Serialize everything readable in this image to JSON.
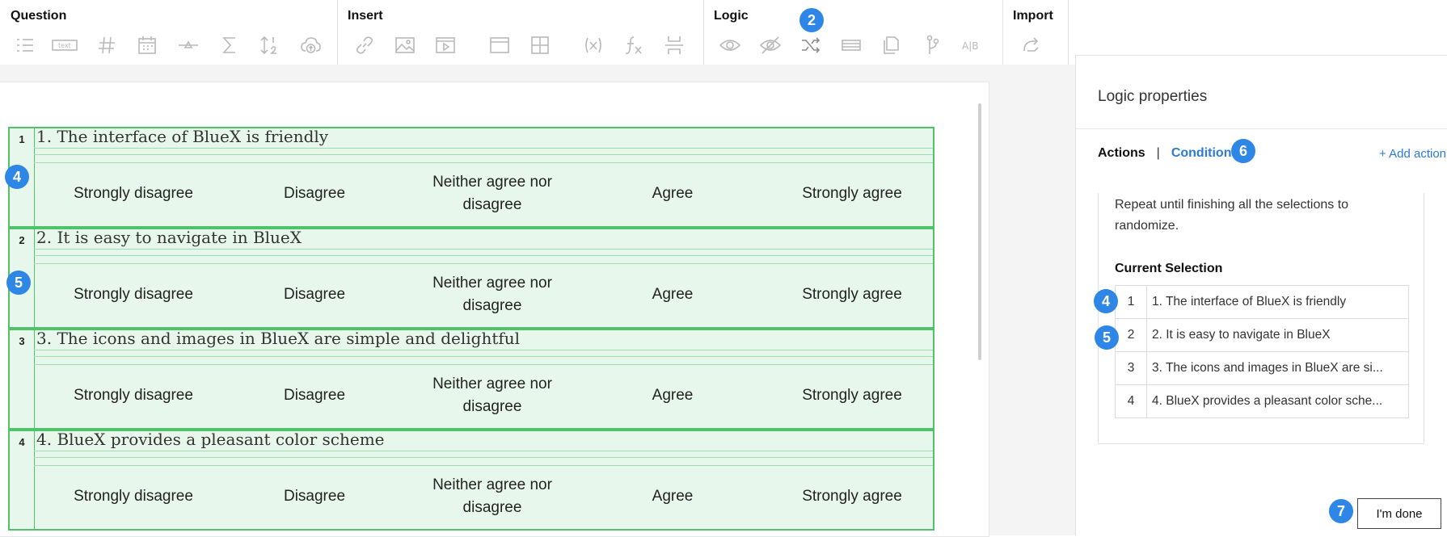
{
  "toolbar": {
    "groups": [
      {
        "title": "Question"
      },
      {
        "title": "Insert"
      },
      {
        "title": "Logic"
      },
      {
        "title": "Import"
      }
    ],
    "text_icon_label": "text"
  },
  "questions": [
    {
      "number": "1",
      "text": "1. The interface of BlueX is friendly"
    },
    {
      "number": "2",
      "text": "2. It is easy to navigate in BlueX"
    },
    {
      "number": "3",
      "text": "3. The icons and images in BlueX are simple and delightful"
    },
    {
      "number": "4",
      "text": "4. BlueX provides a pleasant color scheme"
    }
  ],
  "scale_options": [
    "Strongly disagree",
    "Disagree",
    "Neither agree nor disagree",
    "Agree",
    "Strongly agree"
  ],
  "panel": {
    "title": "Logic properties",
    "tab_actions": "Actions",
    "tab_separator": "|",
    "tab_conditions": "Conditions",
    "add_action": "+ Add action",
    "description": "Repeat until finishing all the selections to randomize.",
    "current_selection_label": "Current Selection",
    "selections": [
      {
        "number": "1",
        "text": "1. The interface of BlueX is friendly"
      },
      {
        "number": "2",
        "text": "2. It is easy to navigate in BlueX"
      },
      {
        "number": "3",
        "text": "3. The icons and images in BlueX are si..."
      },
      {
        "number": "4",
        "text": "4. BlueX provides a pleasant color sche..."
      }
    ],
    "done_button": "I'm done"
  },
  "badges": {
    "logic": "2",
    "q1": "4",
    "q2": "5",
    "conditions": "6",
    "sel1": "4",
    "sel2": "5",
    "done": "7"
  },
  "colors": {
    "accent": "#2e86e6",
    "question_border": "#4fc36a",
    "question_fill": "#e7f7eb",
    "link": "#2d7ad6"
  }
}
